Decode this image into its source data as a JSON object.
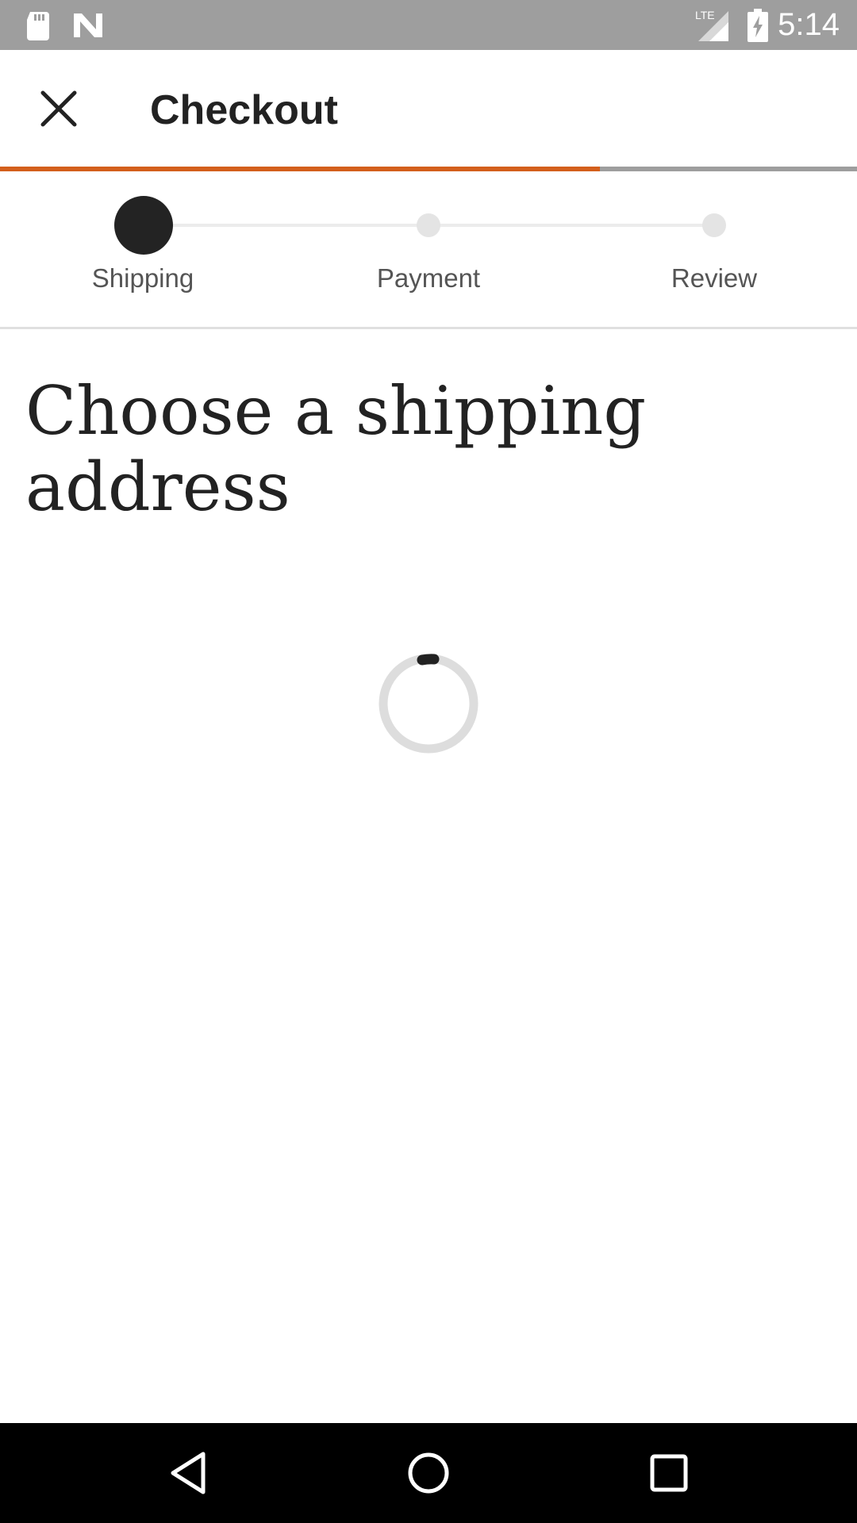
{
  "status_bar": {
    "time": "5:14",
    "network_label": "LTE",
    "icons": [
      "sd-card-icon",
      "n-logo-icon",
      "lte-signal-icon",
      "battery-charging-icon"
    ],
    "background_color": "#9e9e9e"
  },
  "app_bar": {
    "title": "Checkout",
    "close_icon": "close-icon"
  },
  "progress": {
    "fraction": 0.7,
    "fill_color": "#d35f1c",
    "track_color": "#9e9e9e"
  },
  "stepper": {
    "current_step": 0,
    "steps": [
      {
        "label": "Shipping"
      },
      {
        "label": "Payment"
      },
      {
        "label": "Review"
      }
    ]
  },
  "main": {
    "heading": "Choose a shipping address",
    "loading": true
  },
  "nav_bar": {
    "buttons": [
      "back-icon",
      "home-icon",
      "recents-icon"
    ]
  }
}
